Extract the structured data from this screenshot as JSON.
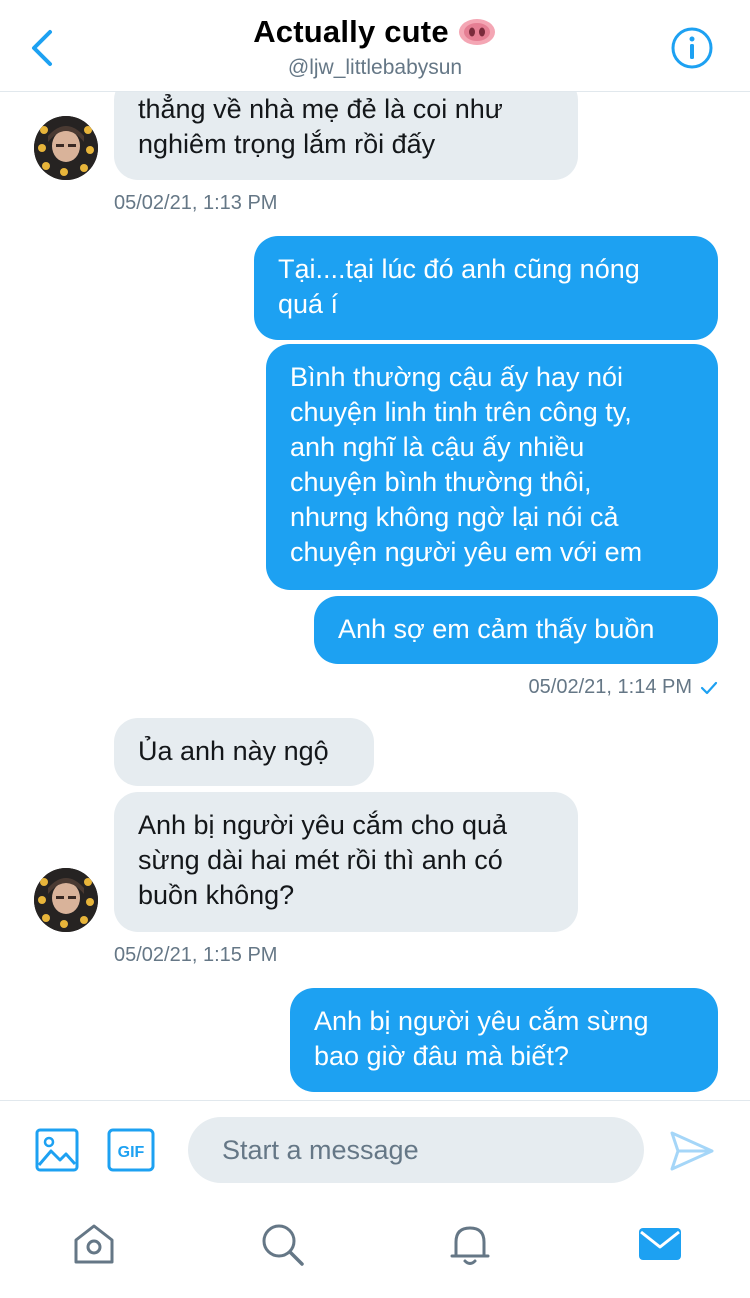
{
  "header": {
    "title": "Actually cute",
    "title_emoji": "pig-nose-icon",
    "handle": "@ljw_littlebabysun"
  },
  "messages": {
    "m1": {
      "direction": "incoming",
      "lines": [
        "thẳng về nhà mẹ đẻ là coi như",
        "nghiêm trọng lắm rồi đấy"
      ]
    },
    "ts1": "05/02/21, 1:13 PM",
    "m2": {
      "direction": "outgoing",
      "lines": [
        "Tại....tại lúc đó anh cũng nóng",
        "quá í"
      ]
    },
    "m3": {
      "direction": "outgoing",
      "lines": [
        "Bình thường cậu ấy hay nói",
        "chuyện linh tinh trên công ty,",
        "anh nghĩ là cậu ấy nhiều",
        "chuyện bình thường thôi,",
        "nhưng không ngờ lại nói cả",
        "chuyện người yêu em với em"
      ]
    },
    "m4": {
      "direction": "outgoing",
      "lines": [
        "Anh sợ em cảm thấy buồn"
      ]
    },
    "ts2": "05/02/21, 1:14 PM",
    "m5": {
      "direction": "incoming",
      "lines": [
        "Ủa anh này ngộ"
      ]
    },
    "m6": {
      "direction": "incoming",
      "lines": [
        "Anh bị người yêu cắm cho quả",
        "sừng dài hai mét rồi thì anh có",
        "buồn không?"
      ]
    },
    "ts3": "05/02/21, 1:15 PM",
    "m7": {
      "direction": "outgoing",
      "lines": [
        "Anh bị người yêu cắm sừng",
        "bao giờ đâu mà biết?"
      ]
    }
  },
  "composer": {
    "placeholder": "Start a message",
    "gif_label": "GIF"
  },
  "tabs": [
    "home-icon",
    "search-icon",
    "notifications-icon",
    "messages-icon"
  ],
  "colors": {
    "accent": "#1da1f2",
    "incoming_bubble": "#e6ecf0",
    "muted_text": "#657786"
  }
}
